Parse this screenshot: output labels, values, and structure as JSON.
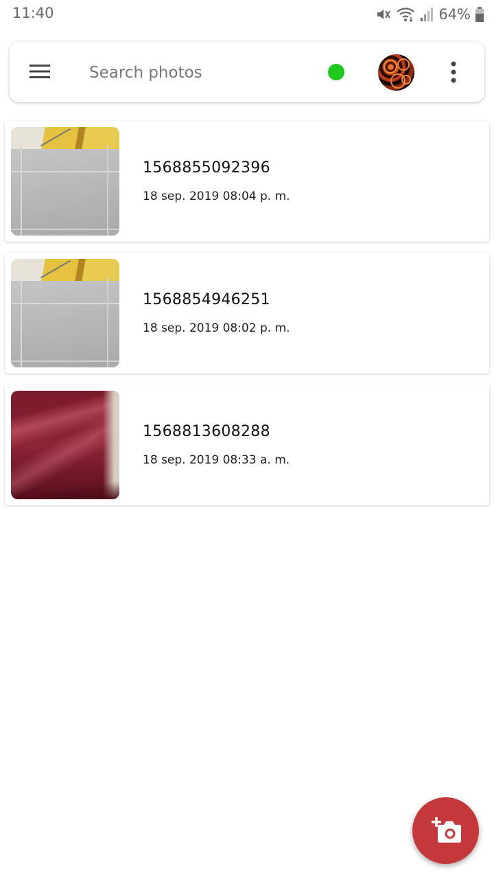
{
  "status_bar": {
    "time": "11:40",
    "battery": "64%",
    "icons": [
      "mute-icon",
      "wifi-icon",
      "signal-icon",
      "battery-icon"
    ]
  },
  "search": {
    "placeholder": "Search photos",
    "value": "",
    "sync_status_color": "#1ec91e"
  },
  "photos": [
    {
      "title": "1568855092396",
      "date": "18 sep. 2019 08:04 p. m.",
      "thumbnail": "ceiling-wall"
    },
    {
      "title": "1568854946251",
      "date": "18 sep. 2019 08:02 p. m.",
      "thumbnail": "ceiling-wall"
    },
    {
      "title": "1568813608288",
      "date": "18 sep. 2019 08:33 a. m.",
      "thumbnail": "red-fabric"
    }
  ],
  "fab": {
    "icon": "add-photo-icon",
    "color": "#c4373b"
  }
}
